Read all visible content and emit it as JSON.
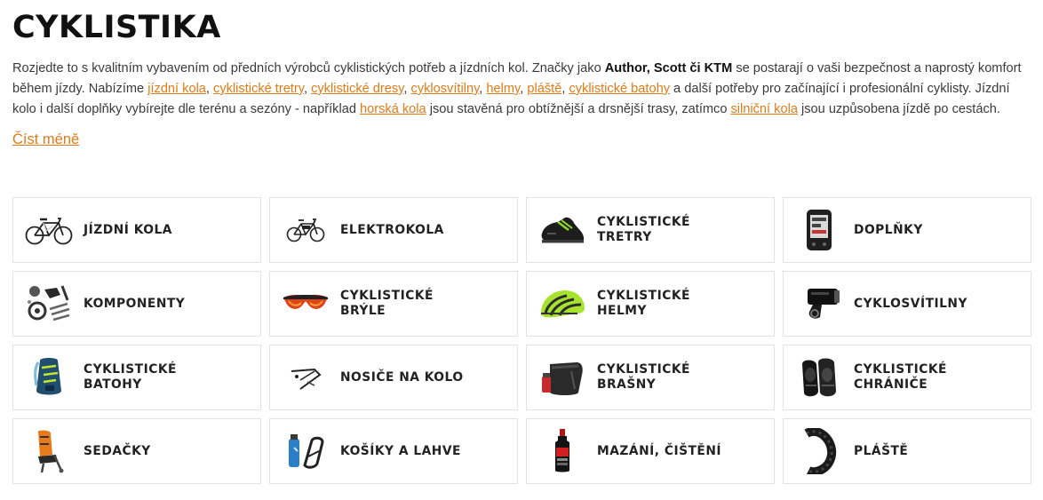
{
  "page_title": "CYKLISTIKA",
  "intro": {
    "t1": "Rozjedte to s kvalitním vybavením od předních výrobců cyklistických potřeb a jízdních kol. Značky jako ",
    "brands": "Author, Scott či KTM",
    "t2": " se postarají o vaši bezpečnost a naprostý komfort během jízdy. Nabízíme ",
    "links": [
      "jízdní kola",
      "cyklistické tretry",
      "cyklistické dresy",
      "cyklosvítilny",
      "helmy",
      "pláště",
      "cyklistické batohy"
    ],
    "sep": ", ",
    "t3": " a další potřeby pro začínající i profesionální cyklisty. Jízdní kolo i další doplňky vybírejte dle terénu a sezóny - například ",
    "link_mtb": "horská kola",
    "t4": " jsou stavěná pro obtížnější a drsnější trasy, zatímco ",
    "link_road": "silniční kola",
    "t5": " jsou uzpůsobena jízdě po cestách."
  },
  "read_less": "Číst méně",
  "categories": [
    {
      "label": "JÍZDNÍ KOLA",
      "icon": "bicycle-icon"
    },
    {
      "label": "ELEKTROKOLA",
      "icon": "ebike-icon"
    },
    {
      "label": "CYKLISTICKÉ TRETRY",
      "icon": "cycling-shoe-icon"
    },
    {
      "label": "DOPLŇKY",
      "icon": "bike-computer-icon"
    },
    {
      "label": "KOMPONENTY",
      "icon": "components-icon"
    },
    {
      "label": "CYKLISTICKÉ BRÝLE",
      "icon": "sunglasses-icon"
    },
    {
      "label": "CYKLISTICKÉ HELMY",
      "icon": "helmet-icon"
    },
    {
      "label": "CYKLOSVÍTILNY",
      "icon": "bike-light-icon"
    },
    {
      "label": "CYKLISTICKÉ BATOHY",
      "icon": "backpack-icon"
    },
    {
      "label": "NOSIČE NA KOLO",
      "icon": "bike-rack-icon"
    },
    {
      "label": "CYKLISTICKÉ BRAŠNY",
      "icon": "saddle-bag-icon"
    },
    {
      "label": "CYKLISTICKÉ CHRÁNIČE",
      "icon": "knee-pad-icon"
    },
    {
      "label": "SEDAČKY",
      "icon": "child-seat-icon"
    },
    {
      "label": "KOŠÍKY A LAHVE",
      "icon": "bottle-cage-icon"
    },
    {
      "label": "MAZÁNÍ, ČIŠTĚNÍ",
      "icon": "lube-bottle-icon"
    },
    {
      "label": "PLÁŠTĚ",
      "icon": "tire-icon"
    }
  ],
  "colors": {
    "accent": "#e07b18",
    "text": "#333333",
    "heading": "#111111",
    "border": "#e3e3e3"
  }
}
